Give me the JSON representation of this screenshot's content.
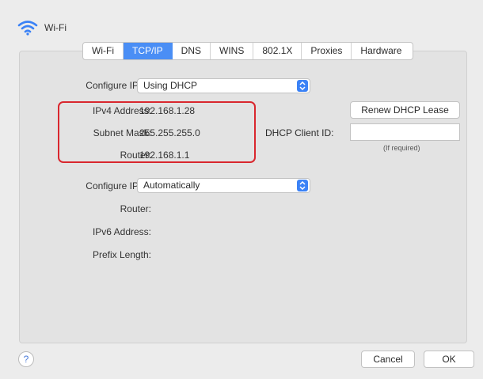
{
  "window": {
    "title": "Wi-Fi"
  },
  "tabs": [
    "Wi-Fi",
    "TCP/IP",
    "DNS",
    "WINS",
    "802.1X",
    "Proxies",
    "Hardware"
  ],
  "active_tab": "TCP/IP",
  "ipv4": {
    "configure_label": "Configure IPv4:",
    "configure_value": "Using DHCP",
    "address_label": "IPv4 Address:",
    "address_value": "192.168.1.28",
    "subnet_label": "Subnet Mask:",
    "subnet_value": "255.255.255.0",
    "router_label": "Router:",
    "router_value": "192.168.1.1"
  },
  "dhcp": {
    "renew_label": "Renew DHCP Lease",
    "client_id_label": "DHCP Client ID:",
    "client_id_value": "",
    "hint": "(If required)"
  },
  "ipv6": {
    "configure_label": "Configure IPv6:",
    "configure_value": "Automatically",
    "router_label": "Router:",
    "address_label": "IPv6 Address:",
    "prefix_label": "Prefix Length:"
  },
  "footer": {
    "help": "?",
    "cancel": "Cancel",
    "ok": "OK"
  },
  "colors": {
    "accent": "#4a8ef5",
    "highlight": "#d9272e"
  }
}
